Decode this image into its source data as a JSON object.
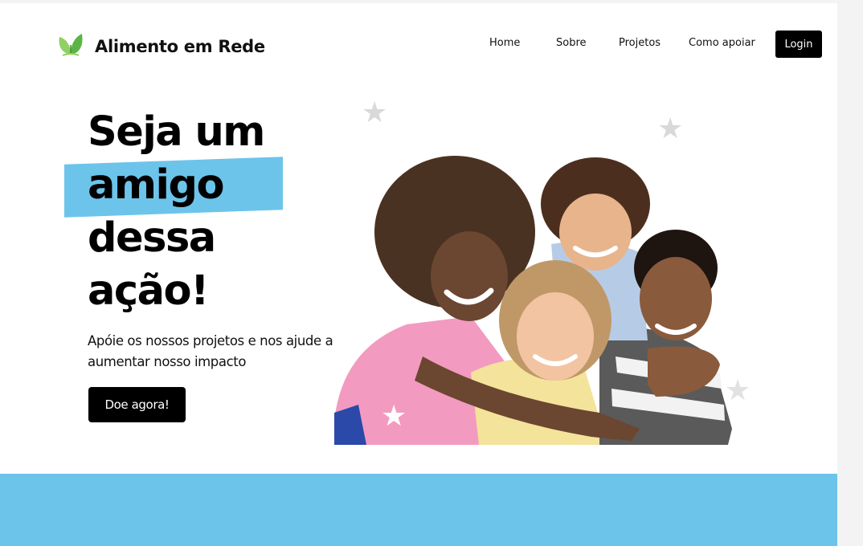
{
  "header": {
    "brand": "Alimento em Rede",
    "nav": [
      "Home",
      "Sobre",
      "Projetos",
      "Como apoiar"
    ],
    "login_label": "Login"
  },
  "hero": {
    "line1": "Seja um",
    "line2": "amigo",
    "line3": "dessa",
    "line4": "ação!",
    "subtitle": "Apóie os nossos projetos e nos ajude a aumentar nosso impacto",
    "cta_label": "Doe agora!"
  },
  "colors": {
    "accent": "#6cc4ea",
    "primary": "#000000",
    "logo_leaf": "#6cc04a"
  },
  "icons": [
    "leaf-logo-icon",
    "star-icon"
  ]
}
